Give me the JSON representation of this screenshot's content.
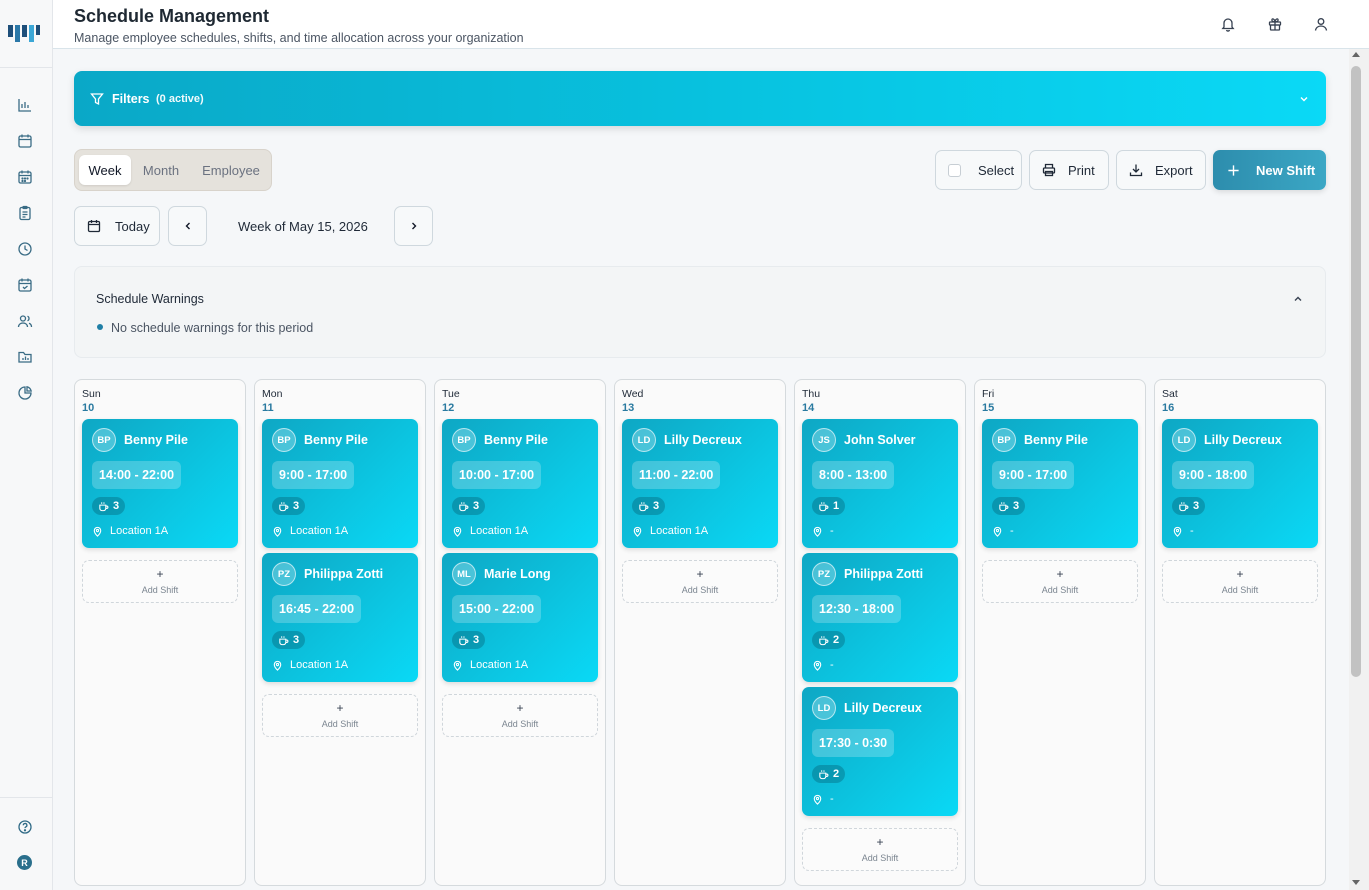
{
  "header": {
    "title": "Schedule Management",
    "subtitle": "Manage employee schedules, shifts, and time allocation across your organization"
  },
  "sidebar": {
    "logo_icon": "company-logo",
    "items": [
      {
        "icon": "bar-chart-icon"
      },
      {
        "icon": "calendar-icon"
      },
      {
        "icon": "calendar-grid-icon"
      },
      {
        "icon": "clipboard-icon"
      },
      {
        "icon": "clock-icon"
      },
      {
        "icon": "calendar-check-icon"
      },
      {
        "icon": "users-icon"
      },
      {
        "icon": "folder-chart-icon"
      },
      {
        "icon": "pie-chart-icon"
      }
    ],
    "help_icon": "help-icon",
    "user_initial": "R"
  },
  "header_actions": [
    "bell-icon",
    "gift-icon",
    "user-icon"
  ],
  "filters": {
    "label": "Filters",
    "count": "(0 active)"
  },
  "view_toggle": {
    "options": [
      "Week",
      "Month",
      "Employee"
    ],
    "active": "Week"
  },
  "toolbar": {
    "select_label": "Select",
    "print_label": "Print",
    "export_label": "Export",
    "new_shift_label": "New Shift"
  },
  "navigation": {
    "today_label": "Today",
    "week_label": "Week of May 15, 2026"
  },
  "warnings": {
    "title": "Schedule Warnings",
    "message": "No schedule warnings for this period"
  },
  "add_shift_label": "Add Shift",
  "days": [
    {
      "name": "Sun",
      "date": "10",
      "shifts": [
        {
          "initials": "BP",
          "name": "Benny Pile",
          "time": "14:00 - 22:00",
          "breaks": "3",
          "location": "Location 1A"
        }
      ]
    },
    {
      "name": "Mon",
      "date": "11",
      "shifts": [
        {
          "initials": "BP",
          "name": "Benny Pile",
          "time": "9:00 - 17:00",
          "breaks": "3",
          "location": "Location 1A"
        },
        {
          "initials": "PZ",
          "name": "Philippa Zotti",
          "time": "16:45 - 22:00",
          "breaks": "3",
          "location": "Location 1A"
        }
      ]
    },
    {
      "name": "Tue",
      "date": "12",
      "shifts": [
        {
          "initials": "BP",
          "name": "Benny Pile",
          "time": "10:00 - 17:00",
          "breaks": "3",
          "location": "Location 1A"
        },
        {
          "initials": "ML",
          "name": "Marie Long",
          "time": "15:00 - 22:00",
          "breaks": "3",
          "location": "Location 1A"
        }
      ]
    },
    {
      "name": "Wed",
      "date": "13",
      "shifts": [
        {
          "initials": "LD",
          "name": "Lilly Decreux",
          "time": "11:00 - 22:00",
          "breaks": "3",
          "location": "Location 1A"
        }
      ]
    },
    {
      "name": "Thu",
      "date": "14",
      "shifts": [
        {
          "initials": "JS",
          "name": "John Solver",
          "time": "8:00 - 13:00",
          "breaks": "1",
          "location": "-"
        },
        {
          "initials": "PZ",
          "name": "Philippa Zotti",
          "time": "12:30 - 18:00",
          "breaks": "2",
          "location": "-"
        },
        {
          "initials": "LD",
          "name": "Lilly Decreux",
          "time": "17:30 - 0:30",
          "breaks": "2",
          "location": "-"
        }
      ]
    },
    {
      "name": "Fri",
      "date": "15",
      "shifts": [
        {
          "initials": "BP",
          "name": "Benny Pile",
          "time": "9:00 - 17:00",
          "breaks": "3",
          "location": "-"
        }
      ]
    },
    {
      "name": "Sat",
      "date": "16",
      "shifts": [
        {
          "initials": "LD",
          "name": "Lilly Decreux",
          "time": "9:00 - 18:00",
          "breaks": "3",
          "location": "-"
        }
      ]
    }
  ]
}
